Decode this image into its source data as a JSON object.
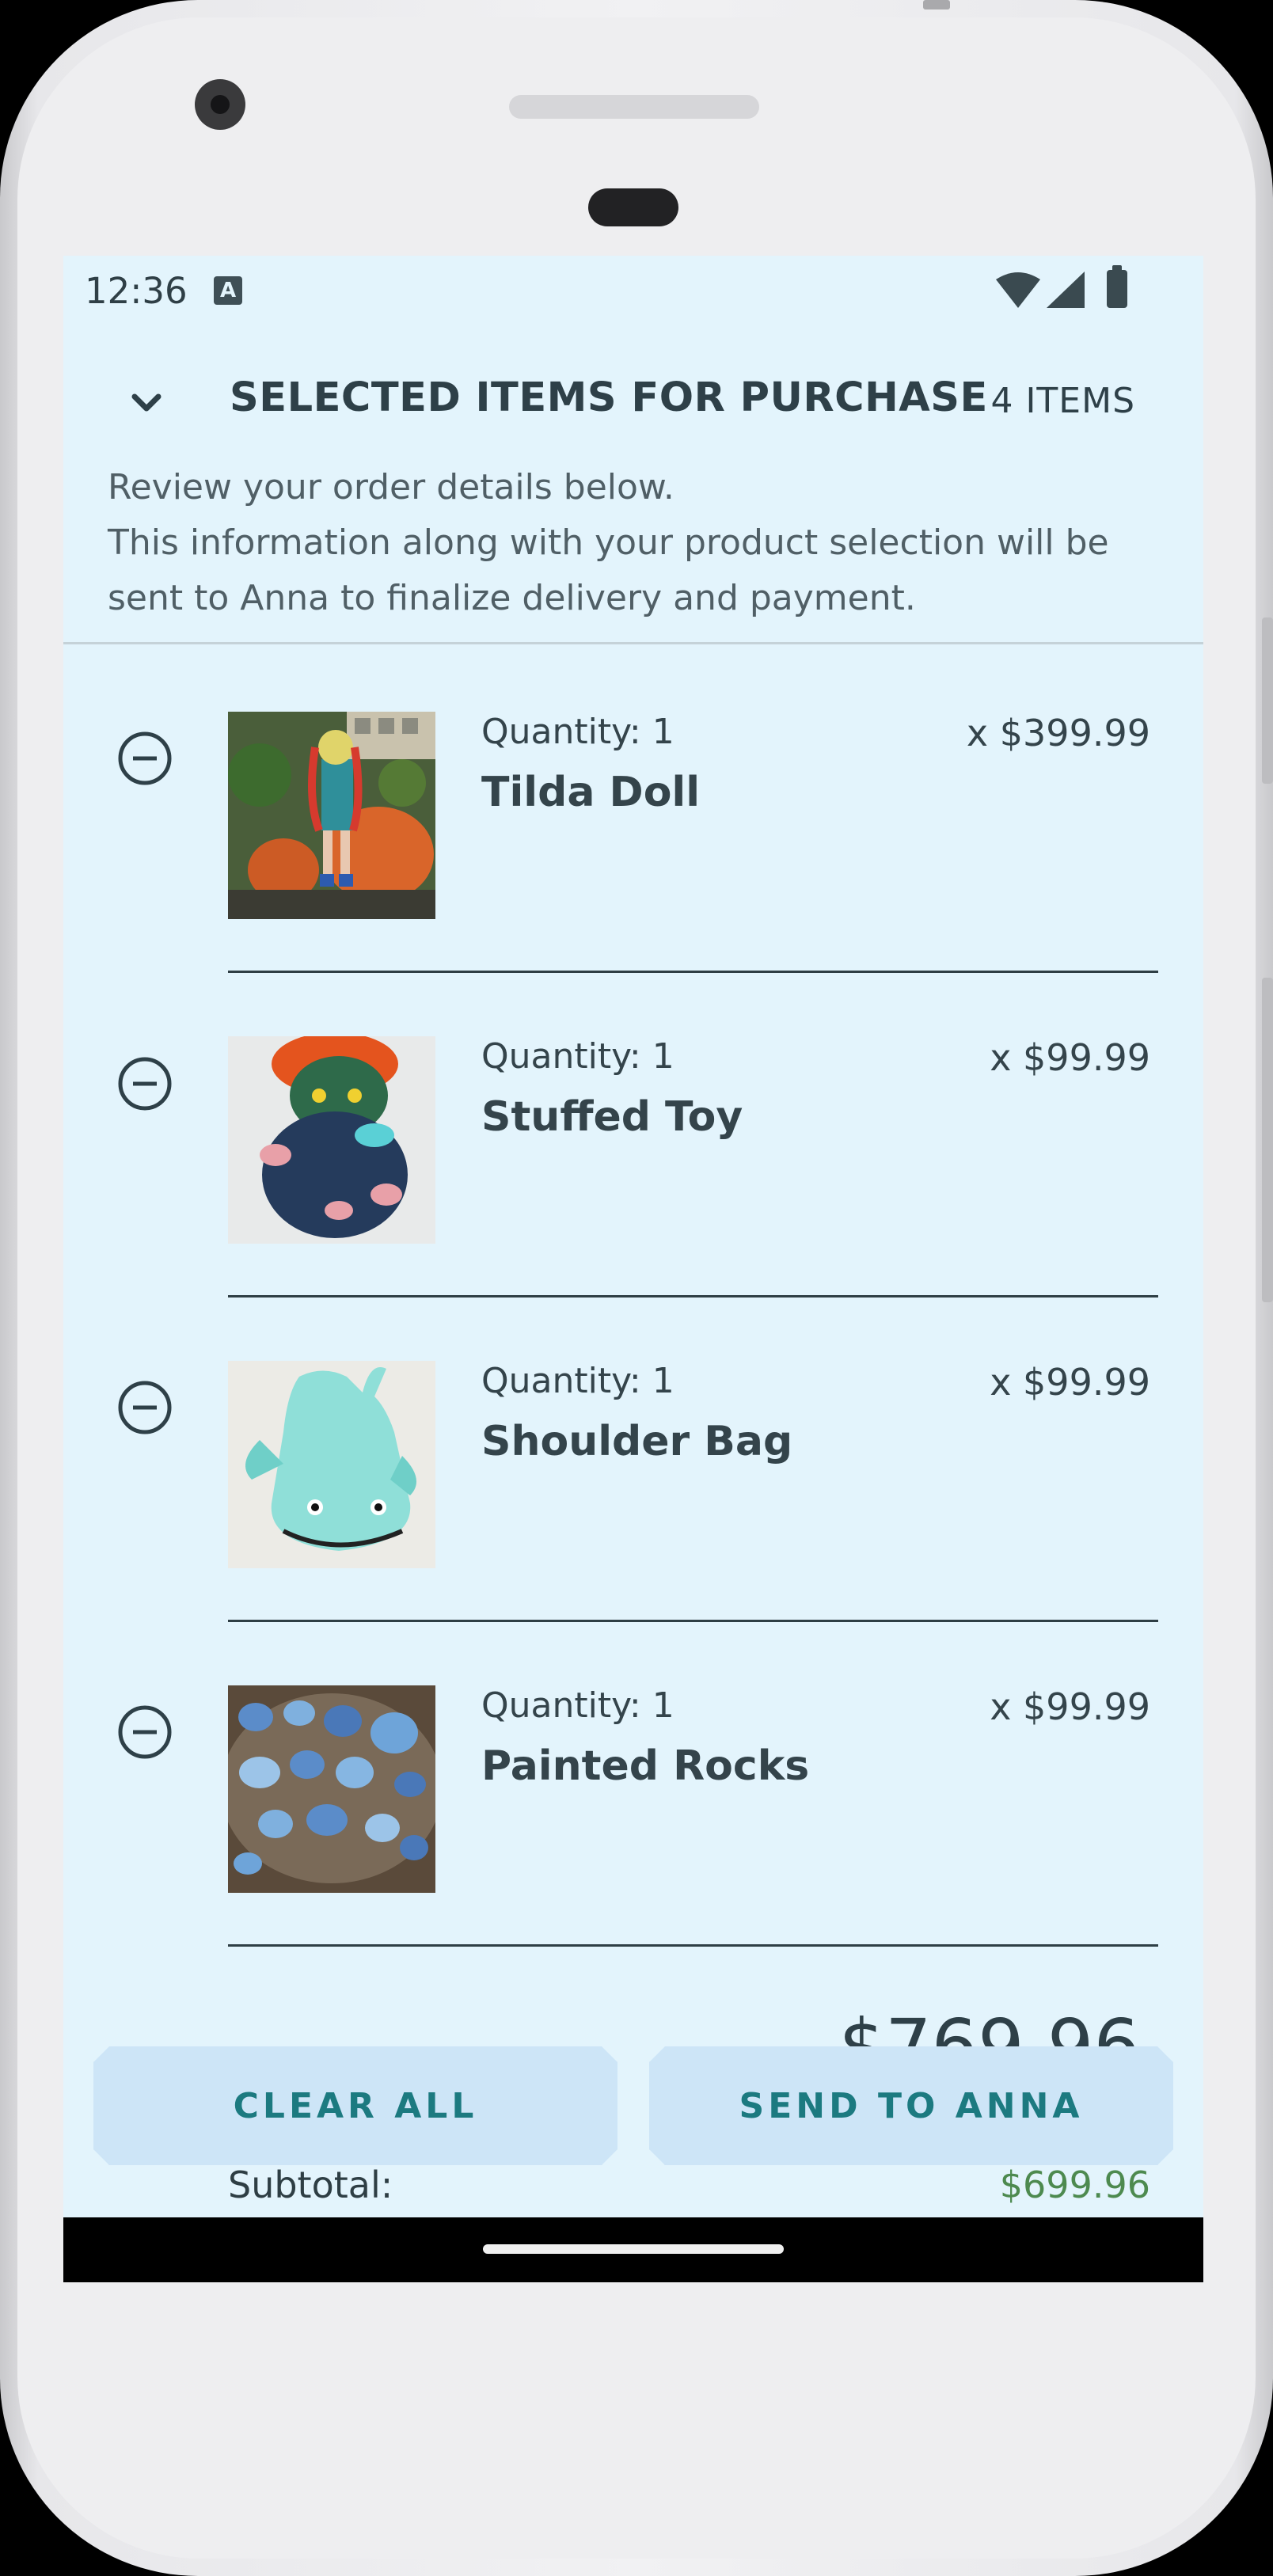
{
  "status": {
    "time": "12:36"
  },
  "header": {
    "title": "SELECTED ITEMS FOR PURCHASE",
    "count": "4 ITEMS",
    "description": "Review your order details below.\nThis information along with your product selection will be sent to Anna to finalize delivery and payment."
  },
  "items": [
    {
      "quantity": "Quantity: 1",
      "name": "Tilda Doll",
      "price": "x $399.99",
      "remove_icon": "minus-circle-icon",
      "image": "knitted doll with pumpkins"
    },
    {
      "quantity": "Quantity: 1",
      "name": "Stuffed Toy",
      "price": "x $99.99",
      "remove_icon": "minus-circle-icon",
      "image": "green stuffed monster toy with orange hair"
    },
    {
      "quantity": "Quantity: 1",
      "name": "Shoulder Bag",
      "price": "x $99.99",
      "remove_icon": "minus-circle-icon",
      "image": "mint whale shaped knitted bag"
    },
    {
      "quantity": "Quantity: 1",
      "name": "Painted Rocks",
      "price": "x $99.99",
      "remove_icon": "minus-circle-icon",
      "image": "blue painted rocks on a tray"
    }
  ],
  "summary": {
    "total_peek": "$769.96",
    "subtotal_label": "Subtotal:",
    "subtotal_value": "$699.96"
  },
  "actions": {
    "clear_label": "CLEAR ALL",
    "send_label": "SEND TO ANNA"
  },
  "colors": {
    "background": "#e3f4fc",
    "text": "#34444b",
    "button_bg": "#cde5f7",
    "button_text": "#1c7a80",
    "subtotal": "#4d8a4f"
  }
}
